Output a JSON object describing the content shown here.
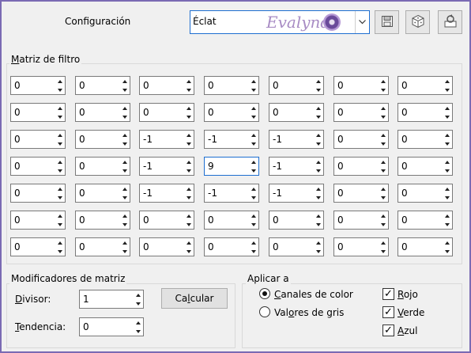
{
  "header": {
    "config_label": "Configuración",
    "preset_value": "Éclat",
    "watermark_text": "Evalynda",
    "save_icon": "floppy-disk-icon",
    "random_icon": "dice-icon",
    "reset_icon": "reset-icon"
  },
  "matrix": {
    "title": "Matriz de filtro",
    "title_accel": "M",
    "title_rest": "atriz de filtro",
    "rows": [
      [
        "0",
        "0",
        "0",
        "0",
        "0",
        "0",
        "0"
      ],
      [
        "0",
        "0",
        "0",
        "0",
        "0",
        "0",
        "0"
      ],
      [
        "0",
        "0",
        "-1",
        "-1",
        "-1",
        "0",
        "0"
      ],
      [
        "0",
        "0",
        "-1",
        "9",
        "-1",
        "0",
        "0"
      ],
      [
        "0",
        "0",
        "-1",
        "-1",
        "-1",
        "0",
        "0"
      ],
      [
        "0",
        "0",
        "0",
        "0",
        "0",
        "0",
        "0"
      ],
      [
        "0",
        "0",
        "0",
        "0",
        "0",
        "0",
        "0"
      ]
    ]
  },
  "modifiers": {
    "title": "Modificadores de matriz",
    "divisor_accel": "D",
    "divisor_rest": "ivisor:",
    "divisor_value": "1",
    "bias_accel": "T",
    "bias_rest": "endencia:",
    "bias_value": "0",
    "calc_pre": "Ca",
    "calc_accel": "l",
    "calc_post": "cular"
  },
  "apply": {
    "title": "Aplicar a",
    "color_accel": "C",
    "color_rest": "anales de color",
    "gray_pre": "Val",
    "gray_accel": "o",
    "gray_post": "res de gris",
    "red_accel": "R",
    "red_rest": "ojo",
    "green_accel": "V",
    "green_rest": "erde",
    "blue_accel": "A",
    "blue_rest": "zul",
    "selected_mode": "color",
    "red_checked": true,
    "green_checked": true,
    "blue_checked": true
  }
}
